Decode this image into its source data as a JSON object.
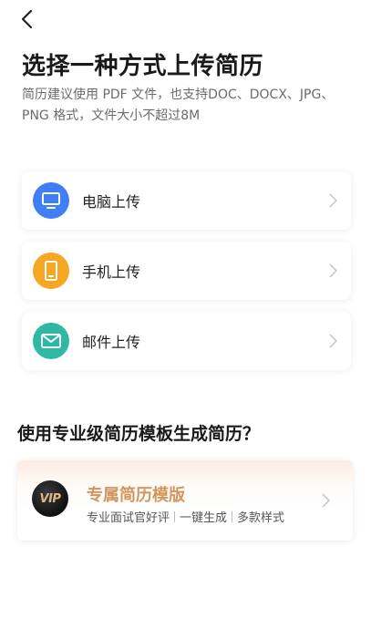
{
  "header": {
    "back_icon": "chevron-left-icon",
    "title": "选择一种方式上传简历",
    "subtitle": "简历建议使用 PDF 文件，也支持DOC、DOCX、JPG、PNG 格式，文件大小不超过8M"
  },
  "upload_options": [
    {
      "label": "电脑上传",
      "icon": "computer-monitor-icon",
      "color": "#3f7ef5"
    },
    {
      "label": "手机上传",
      "icon": "mobile-phone-icon",
      "color": "#f5a623"
    },
    {
      "label": "邮件上传",
      "icon": "mail-envelope-icon",
      "color": "#2fb9a5"
    }
  ],
  "template_section": {
    "heading": "使用专业级简历模板生成简历？",
    "badge_text": "VIP",
    "card_title": "专属简历模版",
    "tags": [
      "专业面试官好评",
      "一键生成",
      "多款样式"
    ],
    "accent_color": "#d4955d"
  }
}
